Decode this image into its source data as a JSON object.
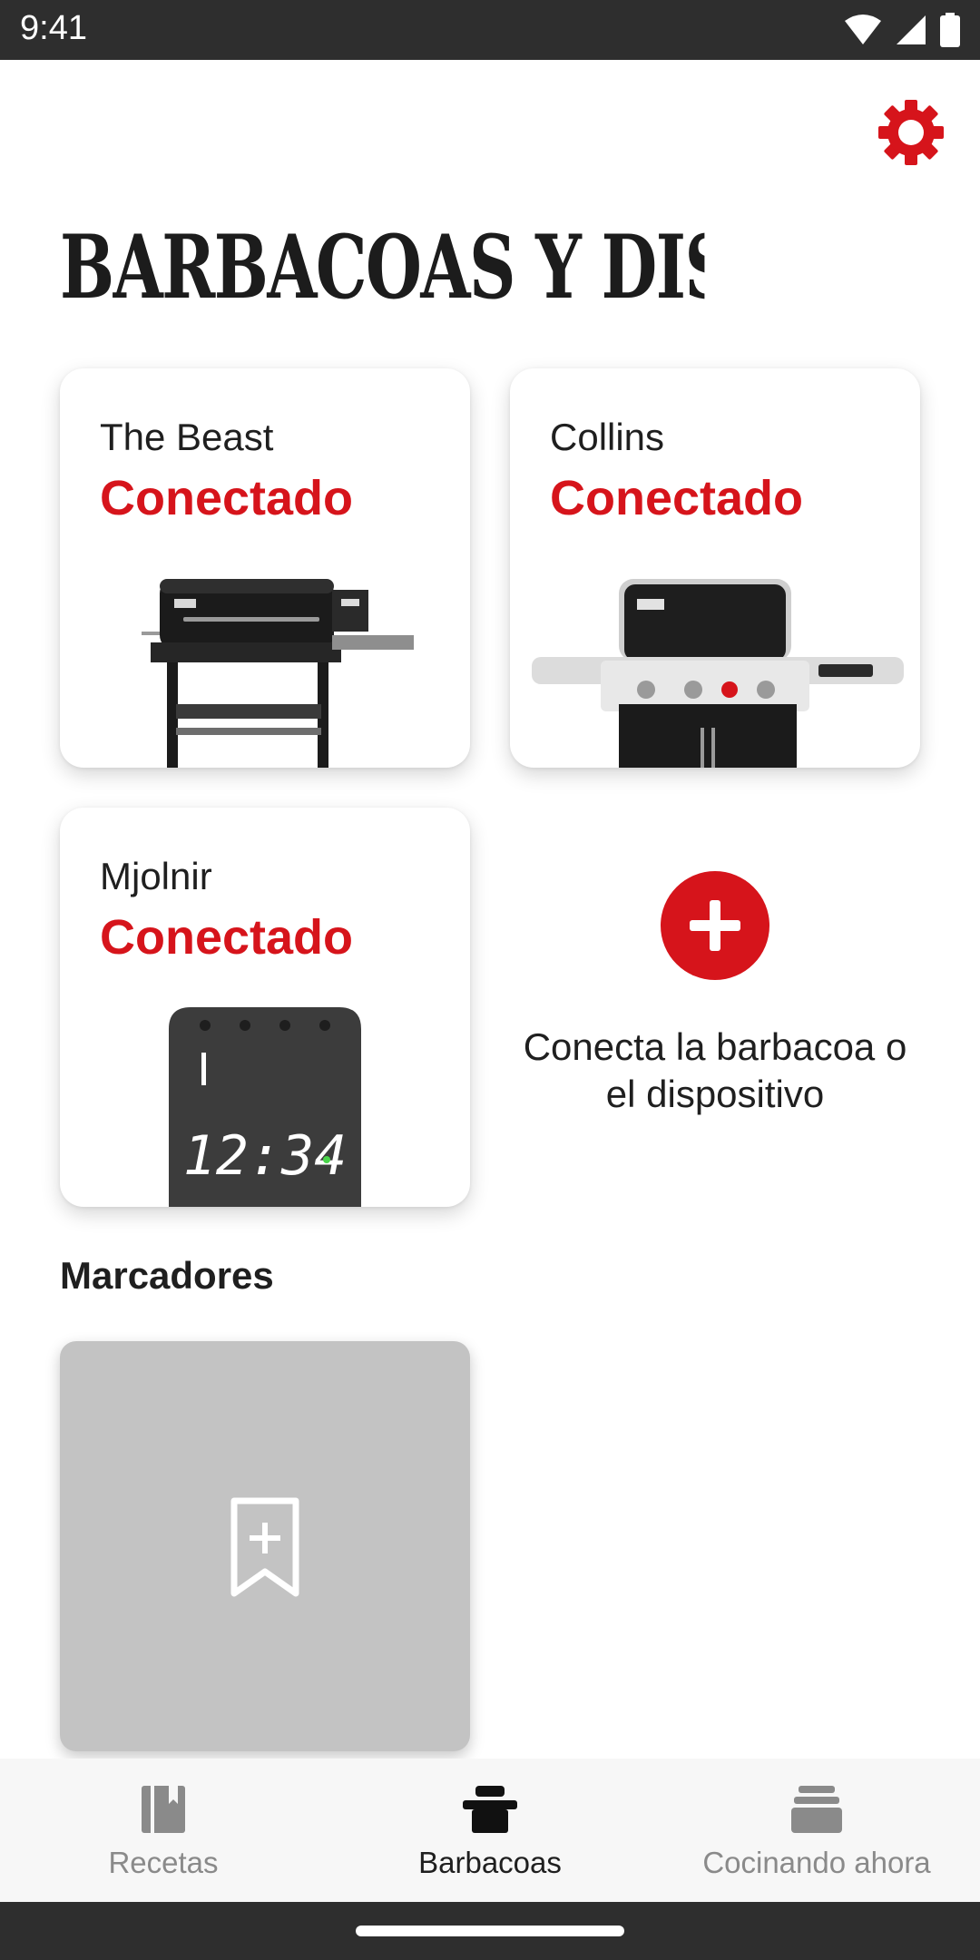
{
  "status_bar": {
    "time": "9:41"
  },
  "header": {
    "title": "BARBACOAS Y DISPOSI..."
  },
  "devices": [
    {
      "name": "The Beast",
      "status": "Conectado",
      "image": "pellet-grill"
    },
    {
      "name": "Collins",
      "status": "Conectado",
      "image": "gas-grill"
    },
    {
      "name": "Mjolnir",
      "status": "Conectado",
      "image": "thermometer-hub",
      "display_time": "12:34"
    }
  ],
  "add_device": {
    "label": "Conecta la barbacoa o el dispositivo"
  },
  "bookmarks": {
    "title": "Marcadores"
  },
  "bottom_nav": {
    "items": [
      {
        "label": "Recetas",
        "icon": "recipes-book-icon"
      },
      {
        "label": "Barbacoas",
        "icon": "grill-icon"
      },
      {
        "label": "Cocinando ahora",
        "icon": "cooking-now-icon"
      }
    ],
    "active": "Barbacoas"
  },
  "colors": {
    "accent": "#d6141b",
    "text": "#1f1f1f",
    "muted": "#8a8a8a",
    "bars": "#2e2e2e"
  }
}
